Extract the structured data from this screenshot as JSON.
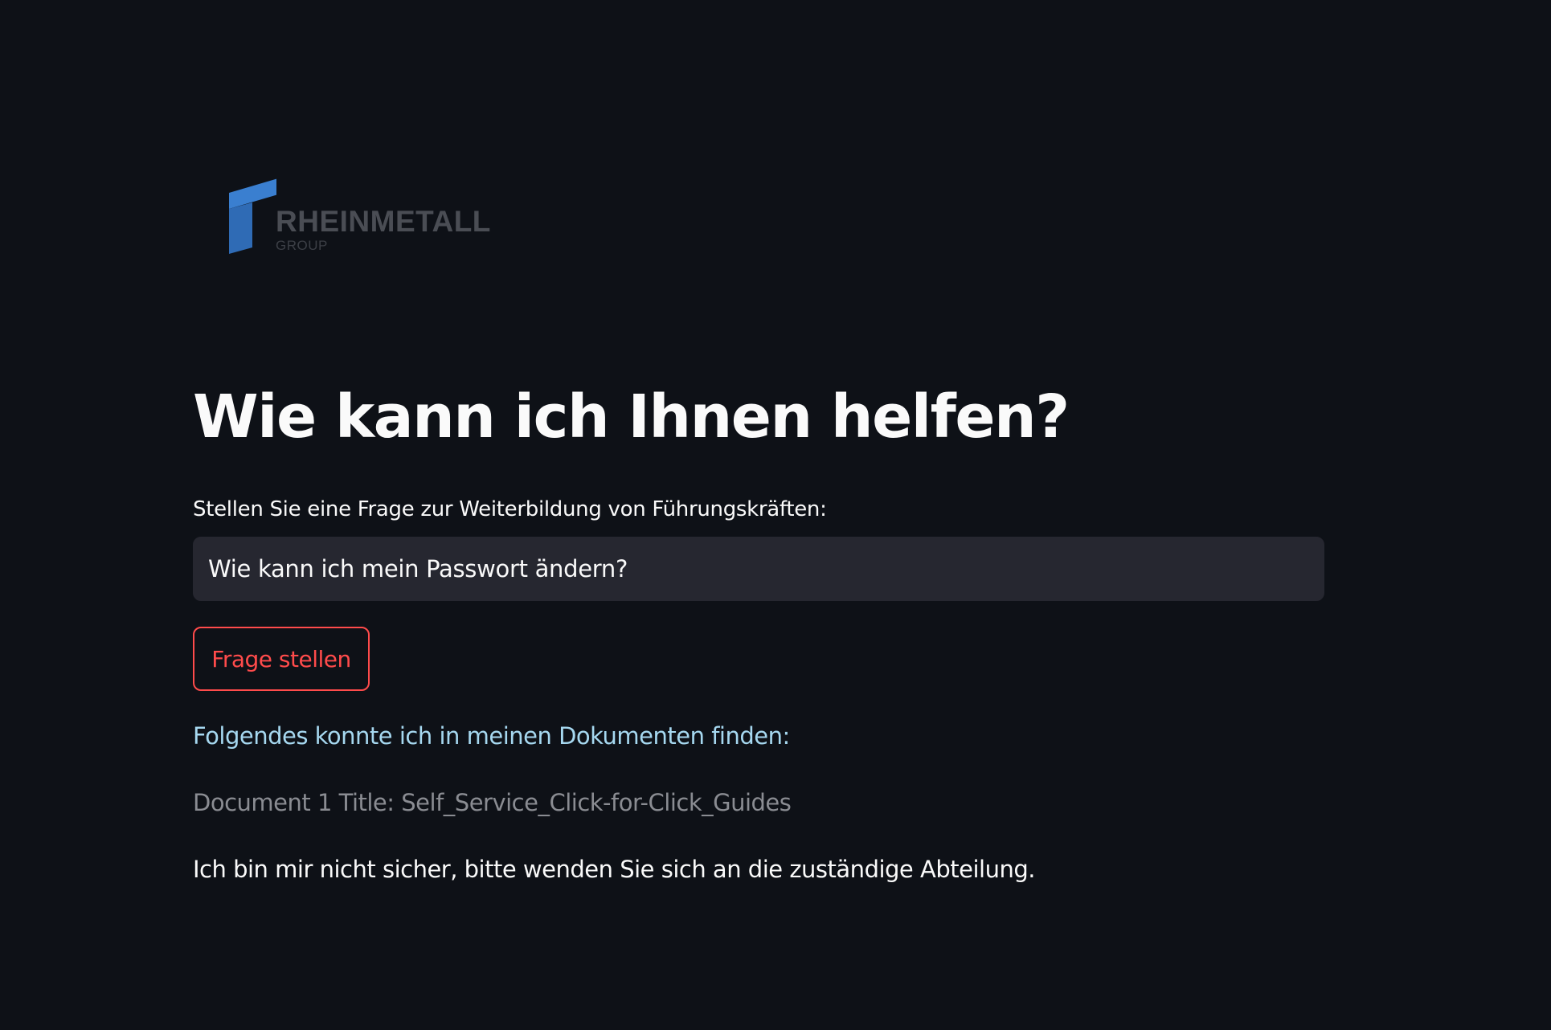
{
  "logo": {
    "wordmark": "RHEINMETALL",
    "subline": "GROUP",
    "brand_color": "#3a7fd0"
  },
  "heading": {
    "title": "Wie kann ich Ihnen helfen?"
  },
  "question_form": {
    "label": "Stellen Sie eine Frage zur Weiterbildung von Führungskräften:",
    "input_value": "Wie kann ich mein Passwort ändern?",
    "submit_label": "Frage stellen"
  },
  "results": {
    "intro": "Folgendes konnte ich in meinen Dokumenten finden:",
    "document_line": "Document 1 Title: Self_Service_Click-for-Click_Guides",
    "answer": "Ich bin mir nicht sicher, bitte wenden Sie sich an die zuständige Abteilung."
  },
  "colors": {
    "background": "#0e1117",
    "input_background": "#262730",
    "accent": "#ff4b4b",
    "info_text": "#a6d8f0",
    "muted_text": "#8a8c92"
  }
}
